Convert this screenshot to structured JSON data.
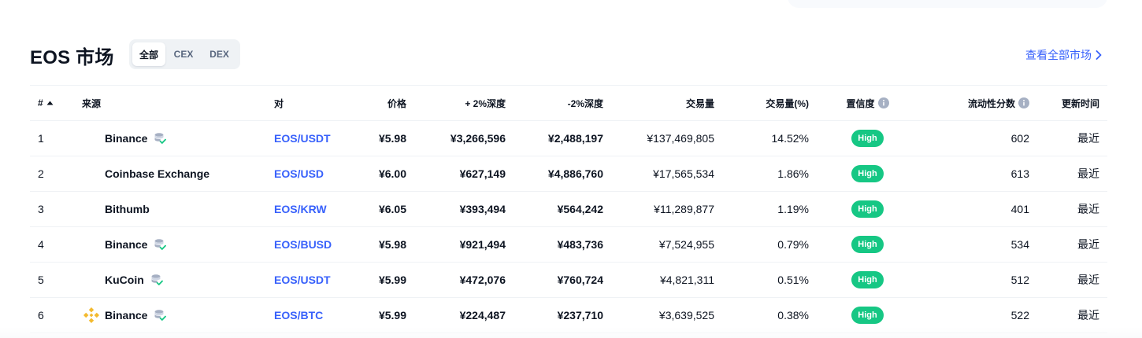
{
  "header": {
    "title": "EOS 市场",
    "filters": [
      {
        "label": "全部",
        "active": true
      },
      {
        "label": "CEX",
        "active": false
      },
      {
        "label": "DEX",
        "active": false
      }
    ],
    "view_all_label": "查看全部市场"
  },
  "table": {
    "columns": {
      "rank": "#",
      "source": "来源",
      "pair": "对",
      "price": "价格",
      "depth_plus": "+ 2%深度",
      "depth_minus": "-2%深度",
      "volume": "交易量",
      "volume_pct": "交易量(%)",
      "confidence": "置信度",
      "liquidity": "流动性分数",
      "updated": "更新时间"
    },
    "rows": [
      {
        "rank": "1",
        "source": "Binance",
        "pair": "EOS/USDT",
        "price": "¥5.98",
        "depth_plus": "¥3,266,596",
        "depth_minus": "¥2,488,197",
        "volume": "¥137,469,805",
        "volume_pct": "14.52%",
        "confidence": "High",
        "liquidity": "602",
        "updated": "最近"
      },
      {
        "rank": "2",
        "source": "Coinbase Exchange",
        "pair": "EOS/USD",
        "price": "¥6.00",
        "depth_plus": "¥627,149",
        "depth_minus": "¥4,886,760",
        "volume": "¥17,565,534",
        "volume_pct": "1.86%",
        "confidence": "High",
        "liquidity": "613",
        "updated": "最近"
      },
      {
        "rank": "3",
        "source": "Bithumb",
        "pair": "EOS/KRW",
        "price": "¥6.05",
        "depth_plus": "¥393,494",
        "depth_minus": "¥564,242",
        "volume": "¥11,289,877",
        "volume_pct": "1.19%",
        "confidence": "High",
        "liquidity": "401",
        "updated": "最近"
      },
      {
        "rank": "4",
        "source": "Binance",
        "pair": "EOS/BUSD",
        "price": "¥5.98",
        "depth_plus": "¥921,494",
        "depth_minus": "¥483,736",
        "volume": "¥7,524,955",
        "volume_pct": "0.79%",
        "confidence": "High",
        "liquidity": "534",
        "updated": "最近"
      },
      {
        "rank": "5",
        "source": "KuCoin",
        "pair": "EOS/USDT",
        "price": "¥5.99",
        "depth_plus": "¥472,076",
        "depth_minus": "¥760,724",
        "volume": "¥4,821,311",
        "volume_pct": "0.51%",
        "confidence": "High",
        "liquidity": "512",
        "updated": "最近"
      },
      {
        "rank": "6",
        "source": "Binance",
        "pair": "EOS/BTC",
        "price": "¥5.99",
        "depth_plus": "¥224,487",
        "depth_minus": "¥237,710",
        "volume": "¥3,639,525",
        "volume_pct": "0.38%",
        "confidence": "High",
        "liquidity": "522",
        "updated": "最近"
      }
    ]
  },
  "icons": {
    "sort": "sort-up-icon",
    "info": "info-icon",
    "verified": "verified-reserves-icon",
    "chevron": "chevron-right-icon",
    "exchange_logo": "binance-logo-icon"
  },
  "colors": {
    "accent": "#3861fb",
    "high_badge": "#16c784",
    "binance_logo": "#f3ba2f"
  }
}
